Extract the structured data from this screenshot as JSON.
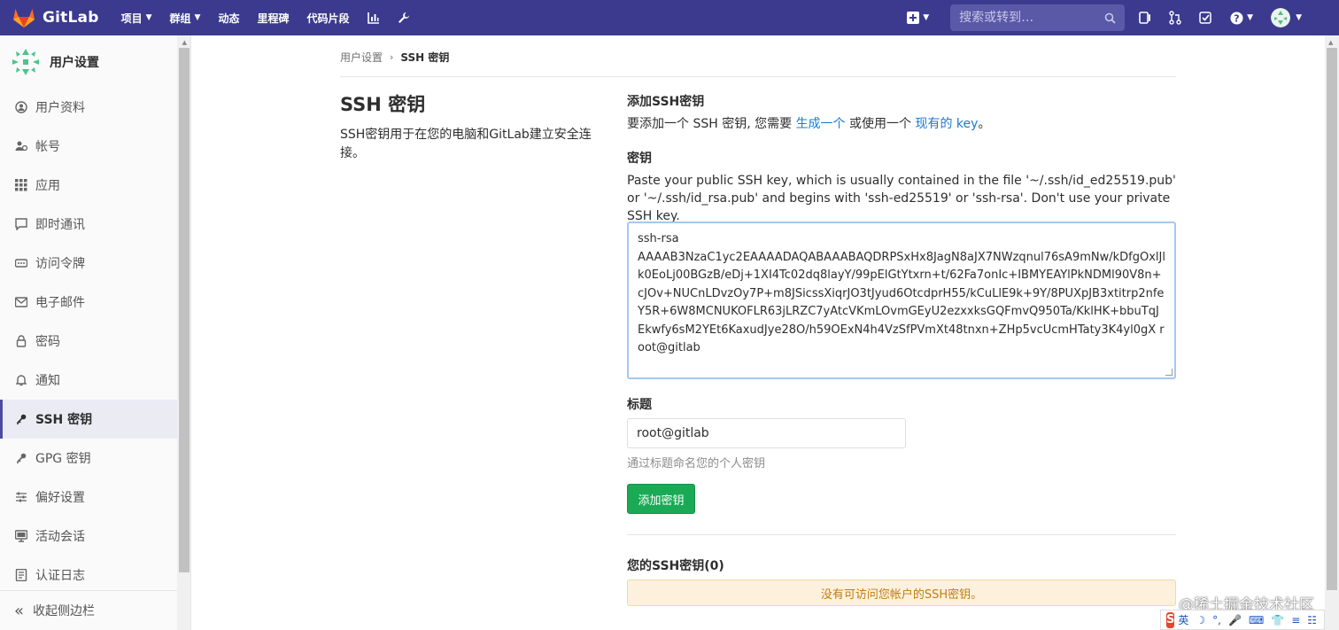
{
  "navbar": {
    "brand": "GitLab",
    "items": [
      {
        "label": "项目",
        "has_caret": true
      },
      {
        "label": "群组",
        "has_caret": true
      },
      {
        "label": "动态",
        "has_caret": false
      },
      {
        "label": "里程碑",
        "has_caret": false
      },
      {
        "label": "代码片段",
        "has_caret": false
      }
    ],
    "search_placeholder": "搜索或转到…",
    "icons": [
      "chart-icon",
      "wrench-icon",
      "plus-icon",
      "search-icon",
      "issues-icon",
      "merge-request-icon",
      "todo-icon",
      "help-icon",
      "avatar"
    ]
  },
  "sidebar": {
    "title": "用户设置",
    "items": [
      {
        "label": "用户资料",
        "icon": "profile-icon",
        "active": false
      },
      {
        "label": "帐号",
        "icon": "account-icon",
        "active": false
      },
      {
        "label": "应用",
        "icon": "applications-icon",
        "active": false
      },
      {
        "label": "即时通讯",
        "icon": "chat-icon",
        "active": false
      },
      {
        "label": "访问令牌",
        "icon": "token-icon",
        "active": false
      },
      {
        "label": "电子邮件",
        "icon": "email-icon",
        "active": false
      },
      {
        "label": "密码",
        "icon": "lock-icon",
        "active": false
      },
      {
        "label": "通知",
        "icon": "bell-icon",
        "active": false
      },
      {
        "label": "SSH 密钥",
        "icon": "key-icon",
        "active": true
      },
      {
        "label": "GPG 密钥",
        "icon": "key-icon",
        "active": false
      },
      {
        "label": "偏好设置",
        "icon": "preferences-icon",
        "active": false
      },
      {
        "label": "活动会话",
        "icon": "monitor-icon",
        "active": false
      },
      {
        "label": "认证日志",
        "icon": "log-icon",
        "active": false
      }
    ],
    "collapse_label": "收起侧边栏"
  },
  "breadcrumb": {
    "parent": "用户设置",
    "current": "SSH 密钥"
  },
  "left": {
    "title": "SSH 密钥",
    "description": "SSH密钥用于在您的电脑和GitLab建立安全连接。"
  },
  "form": {
    "add_heading": "添加SSH密钥",
    "add_text_prefix": "要添加一个 SSH 密钥, 您需要 ",
    "generate_link": "生成一个",
    "add_text_middle": " 或使用一个 ",
    "existing_link": "现有的 key",
    "add_text_suffix": "。",
    "key_label": "密钥",
    "key_help": "Paste your public SSH key, which is usually contained in the file '~/.ssh/id_ed25519.pub' or '~/.ssh/id_rsa.pub' and begins with 'ssh-ed25519' or 'ssh-rsa'. Don't use your private SSH key.",
    "key_value": "ssh-rsa\nAAAAB3NzaC1yc2EAAAADAQABAAABAQDRPSxHx8JagN8aJX7NWzqnul76sA9mNw/kDfgOxlJlk0EoLj00BGzB/eDj+1XI4Tc02dq8layY/99pElGtYtxrn+t/62Fa7onIc+IBMYEAYlPkNDMl90V8n+cJOv+NUCnLDvzOy7P+m8JSicssXiqrJO3tJyud6OtcdprH55/kCuLlE9k+9Y/8PUXpJB3xtitrp2nfeY5R+6W8MCNUKOFLR63jLRZC7yAtcVKmLOvmGEyU2ezxxksGQFmvQ950Ta/KklHK+bbuTqJEkwfy6sM2YEt6KaxudJye28O/h59OExN4h4VzSfPVmXt48tnxn+ZHp5vcUcmHTaty3K4yl0gX root@gitlab",
    "title_label": "标题",
    "title_value": "root@gitlab",
    "title_help": "通过标题命名您的个人密钥",
    "submit_label": "添加密钥",
    "your_keys_heading": "您的SSH密钥(0)",
    "no_keys_alert": "没有可访问您帐户的SSH密钥。"
  },
  "watermark": "@稀土掘金技术社区",
  "ime": {
    "logo": "S",
    "segments": [
      "英",
      "☽",
      "°,",
      "🎤",
      "⌨",
      "👕",
      "≡",
      "☷"
    ]
  },
  "colors": {
    "navbar": "#3b3a8e",
    "accent": "#4b4ba3",
    "link": "#1f78d1",
    "success": "#1aaa55",
    "warning_bg": "#fdf1dd",
    "warning_text": "#c17d10"
  }
}
